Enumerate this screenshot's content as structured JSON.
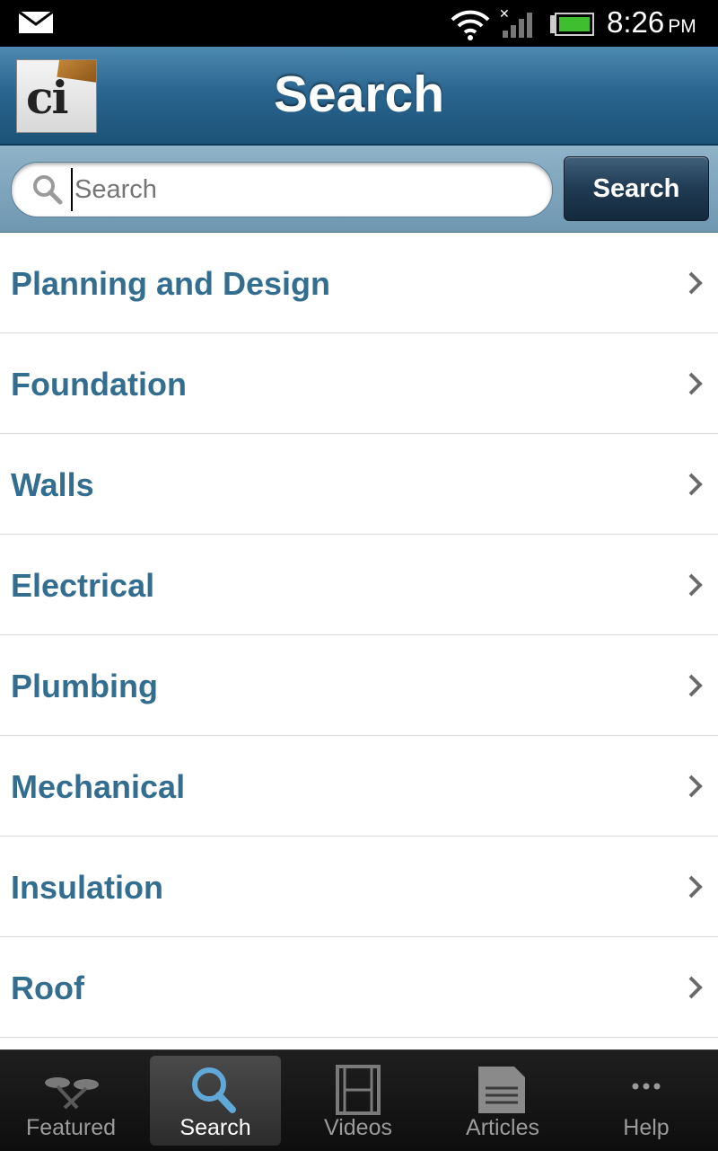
{
  "status_bar": {
    "time": "8:26",
    "ampm": "PM",
    "icons": [
      "mail-icon",
      "wifi-icon",
      "signal-icon",
      "battery-icon"
    ]
  },
  "header": {
    "title": "Search",
    "logo_text": "ci"
  },
  "search": {
    "placeholder": "Search",
    "value": "",
    "button_label": "Search"
  },
  "categories": [
    "Planning and Design",
    "Foundation",
    "Walls",
    "Electrical",
    "Plumbing",
    "Mechanical",
    "Insulation",
    "Roof"
  ],
  "tabs": [
    {
      "label": "Featured",
      "icon": "featured-icon",
      "active": false
    },
    {
      "label": "Search",
      "icon": "magnifier-icon",
      "active": true
    },
    {
      "label": "Videos",
      "icon": "film-icon",
      "active": false
    },
    {
      "label": "Articles",
      "icon": "document-icon",
      "active": false
    },
    {
      "label": "Help",
      "icon": "ellipsis-icon",
      "active": false
    }
  ],
  "colors": {
    "header": "#2a6690",
    "list_text": "#336e90",
    "tab_active_text": "#ffffff",
    "tab_inactive_text": "#9b9b9b"
  }
}
